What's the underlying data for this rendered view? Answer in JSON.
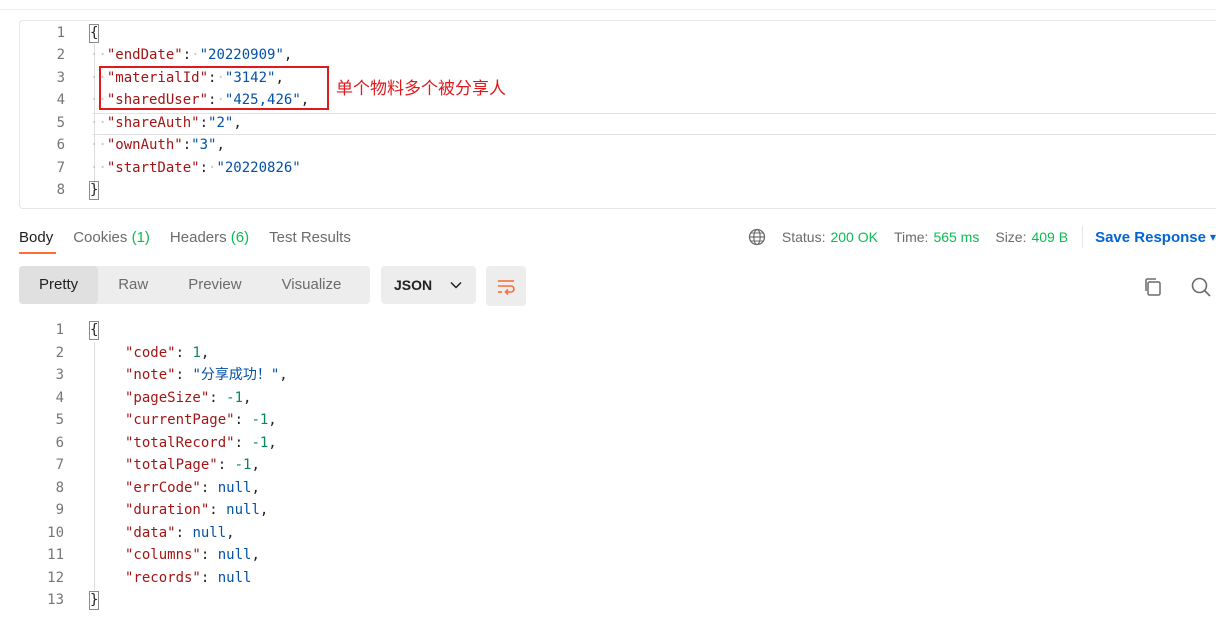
{
  "request_body": {
    "lines": [
      {
        "num": "1"
      },
      {
        "num": "2",
        "key": "\"endDate\"",
        "value": "\"20220909\""
      },
      {
        "num": "3",
        "key": "\"materialId\"",
        "value": "\"3142\""
      },
      {
        "num": "4",
        "key": "\"sharedUser\"",
        "value": "\"425,426\""
      },
      {
        "num": "5",
        "key": "\"shareAuth\"",
        "value": "\"2\""
      },
      {
        "num": "6",
        "key": "\"ownAuth\"",
        "value": "\"3\""
      },
      {
        "num": "7",
        "key": "\"startDate\"",
        "value": "\"20220826\""
      },
      {
        "num": "8"
      }
    ],
    "open_brace": "{",
    "close_brace": "}",
    "annotation": "单个物料多个被分享人"
  },
  "response_tabs": [
    {
      "label": "Body"
    },
    {
      "label": "Cookies",
      "count": "(1)"
    },
    {
      "label": "Headers",
      "count": "(6)"
    },
    {
      "label": "Test Results"
    }
  ],
  "status": {
    "status_label": "Status:",
    "status_value": "200 OK",
    "time_label": "Time:",
    "time_value": "565 ms",
    "size_label": "Size:",
    "size_value": "409 B",
    "save_label": "Save Response"
  },
  "view_modes": [
    "Pretty",
    "Raw",
    "Preview",
    "Visualize"
  ],
  "format": "JSON",
  "response_body": {
    "lines": [
      {
        "num": "1"
      },
      {
        "num": "2",
        "key": "\"code\"",
        "value": "1"
      },
      {
        "num": "3",
        "key": "\"note\"",
        "value": "\"分享成功！\""
      },
      {
        "num": "4",
        "key": "\"pageSize\"",
        "value": "-1"
      },
      {
        "num": "5",
        "key": "\"currentPage\"",
        "value": "-1"
      },
      {
        "num": "6",
        "key": "\"totalRecord\"",
        "value": "-1"
      },
      {
        "num": "7",
        "key": "\"totalPage\"",
        "value": "-1"
      },
      {
        "num": "8",
        "key": "\"errCode\"",
        "value": "null"
      },
      {
        "num": "9",
        "key": "\"duration\"",
        "value": "null"
      },
      {
        "num": "10",
        "key": "\"data\"",
        "value": "null"
      },
      {
        "num": "11",
        "key": "\"columns\"",
        "value": "null"
      },
      {
        "num": "12",
        "key": "\"records\"",
        "value": "null"
      },
      {
        "num": "13"
      }
    ],
    "open_brace": "{",
    "close_brace": "}"
  },
  "colors": {
    "accent": "#ff6c37",
    "success": "#0cbb52",
    "link": "#0265d2",
    "annotation": "#e0191e"
  },
  "icons": [
    "globe-icon",
    "chevron-down-icon",
    "wrap-lines-icon",
    "copy-icon",
    "search-icon"
  ]
}
